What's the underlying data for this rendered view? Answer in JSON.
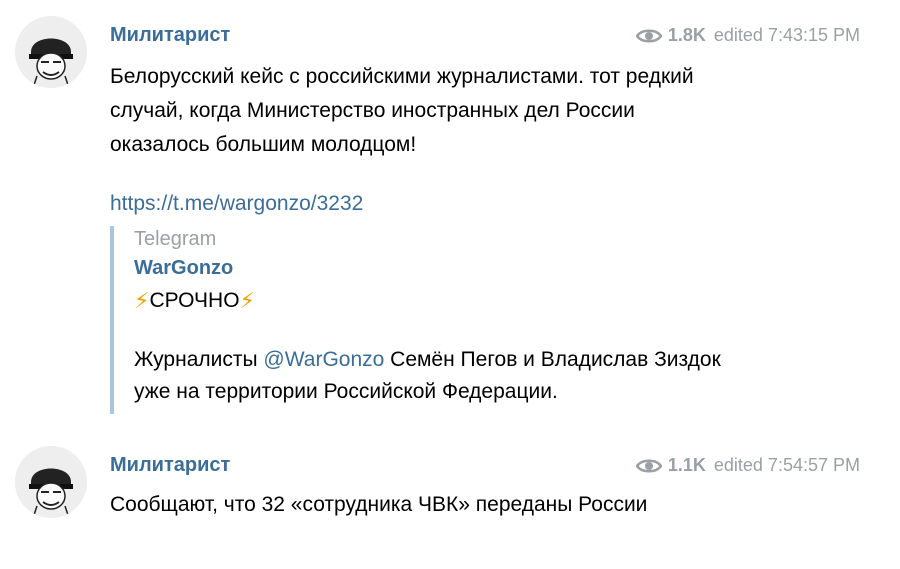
{
  "messages": [
    {
      "author": "Милитарист",
      "views": "1.8K",
      "edited": "edited 7:43:15 PM",
      "text": "Белорусский кейс с российскими журналистами. тот редкий случай, когда Министерство иностранных дел России оказалось большим молодцом!",
      "link": "https://t.me/wargonzo/3232",
      "preview": {
        "site": "Telegram",
        "title": "WarGonzo",
        "urgent": "СРОЧНО",
        "body_prefix": "Журналисты ",
        "mention": "@WarGonzo",
        "body_suffix": " Семён Пегов и Владислав Зиздок уже на территории Российской Федерации."
      }
    },
    {
      "author": "Милитарист",
      "views": "1.1K",
      "edited": "edited 7:54:57 PM",
      "text": "Сообщают, что 32 «сотрудника ЧВК» переданы России"
    }
  ],
  "colors": {
    "link": "#3a6d99",
    "meta": "#9aa0a6",
    "preview_border": "#a9c6df",
    "bolt": "#f0a400"
  },
  "icons": {
    "views": "eye-icon",
    "urgent": "lightning-icon",
    "avatar": "helmet-avatar"
  }
}
